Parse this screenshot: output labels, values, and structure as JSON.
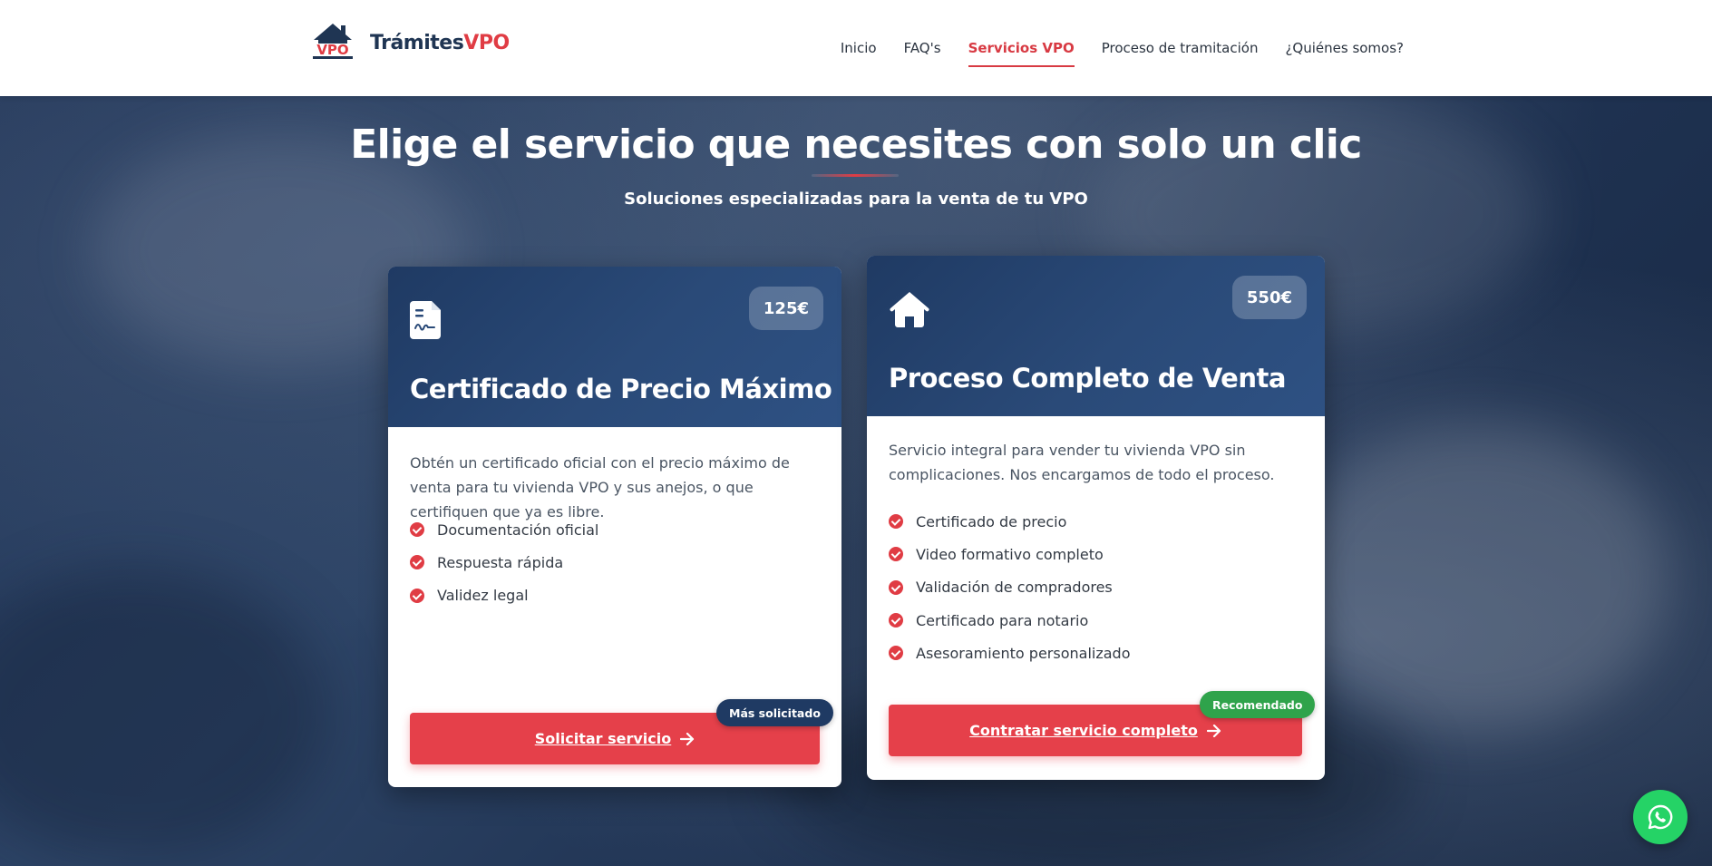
{
  "header": {
    "logo_badge": "VPO",
    "logo_part1": "Trámites",
    "logo_part2": "VPO",
    "nav": [
      {
        "label": "Inicio",
        "active": false
      },
      {
        "label": "FAQ's",
        "active": false
      },
      {
        "label": "Servicios VPO",
        "active": true
      },
      {
        "label": "Proceso de tramitación",
        "active": false
      },
      {
        "label": "¿Quiénes somos?",
        "active": false
      }
    ]
  },
  "hero": {
    "title": "Elige el servicio que necesites con solo un clic",
    "subtitle": "Soluciones especializadas para la venta de tu VPO"
  },
  "cards": [
    {
      "icon": "document-certificate-icon",
      "price": "125€",
      "title": "Certificado de Precio Máximo",
      "description": "Obtén un certificado oficial con el precio máximo de venta para tu vivienda VPO y sus anejos, o que certifiquen que ya es libre.",
      "features": [
        "Documentación oficial",
        "Respuesta rápida",
        "Validez legal"
      ],
      "cta": "Solicitar servicio",
      "ribbon": "Más solicitado"
    },
    {
      "icon": "house-icon",
      "price": "550€",
      "title": "Proceso Completo de Venta",
      "description": "Servicio integral para vender tu vivienda VPO sin complicaciones. Nos encargamos de todo el proceso.",
      "features": [
        "Certificado de precio",
        "Video formativo completo",
        "Validación de compradores",
        "Certificado para notario",
        "Asesoramiento personalizado"
      ],
      "cta": "Contratar servicio completo",
      "ribbon": "Recomendado"
    }
  ],
  "colors": {
    "brand_navy": "#1f3553",
    "brand_red": "#e03c44",
    "ribbon_green": "#2fa34b",
    "whatsapp_green": "#25d366"
  },
  "whatsapp": {
    "icon": "whatsapp-icon"
  }
}
